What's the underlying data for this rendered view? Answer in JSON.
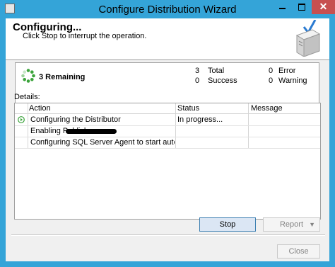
{
  "window": {
    "title": "Configure Distribution Wizard"
  },
  "header": {
    "title": "Configuring...",
    "subtitle": "Click Stop to interrupt the operation."
  },
  "summary": {
    "remaining_label": "3 Remaining",
    "total_count": "3",
    "total_label": "Total",
    "success_count": "0",
    "success_label": "Success",
    "error_count": "0",
    "error_label": "Error",
    "warning_count": "0",
    "warning_label": "Warning"
  },
  "details": {
    "label": "Details:",
    "columns": [
      "Action",
      "Status",
      "Message"
    ],
    "rows": [
      {
        "action": "Configuring the Distributor",
        "status": "In progress...",
        "message": ""
      },
      {
        "action": "Enabling Publisher",
        "status": "",
        "message": ""
      },
      {
        "action": "Configuring SQL Server Agent to start automati...",
        "status": "",
        "message": ""
      }
    ]
  },
  "buttons": {
    "stop": "Stop",
    "report": "Report",
    "close": "Close"
  },
  "colors": {
    "accent": "#34a4d8",
    "close_button": "#c75050",
    "progress": "#3aa33a"
  }
}
